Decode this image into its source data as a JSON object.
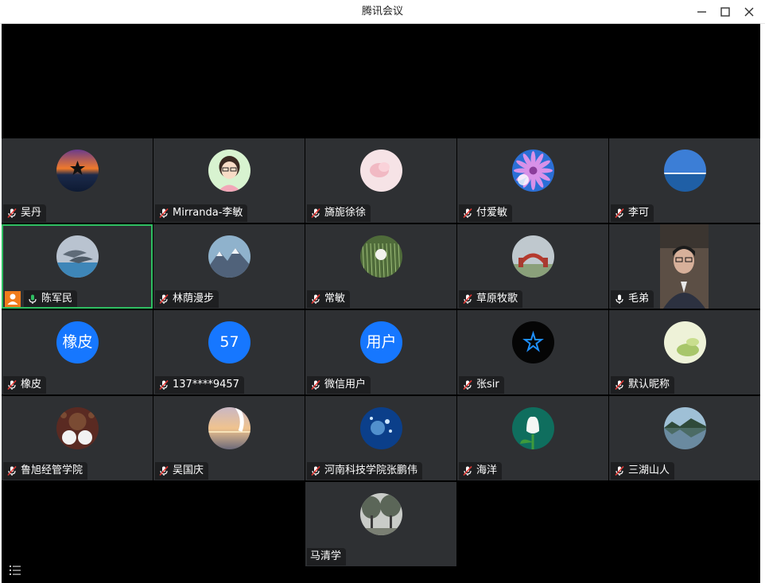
{
  "window": {
    "title": "腾讯会议"
  },
  "colors": {
    "accent_blue": "#1677ff",
    "active_border": "#2fbf62",
    "tile_bg": "#2e3033",
    "muted_red": "#e53935",
    "mic_on": "#2fbf62"
  },
  "participants": [
    {
      "name": "吴丹",
      "mic": "muted",
      "avatar": "sunset-star"
    },
    {
      "name": "Mirranda-李敏",
      "mic": "muted",
      "avatar": "cartoon-girl"
    },
    {
      "name": "旖旎徐徐",
      "mic": "muted",
      "avatar": "pink-flower"
    },
    {
      "name": "付爱敏",
      "mic": "muted",
      "avatar": "purple-daisy"
    },
    {
      "name": "李可",
      "mic": "muted",
      "avatar": "blue-sea"
    },
    {
      "name": "陈军民",
      "mic": "on",
      "avatar": "dolphins",
      "active": true,
      "host": true
    },
    {
      "name": "林荫漫步",
      "mic": "muted",
      "avatar": "mountains"
    },
    {
      "name": "常敏",
      "mic": "muted",
      "avatar": "dandelion"
    },
    {
      "name": "草原牧歌",
      "mic": "muted",
      "avatar": "gate"
    },
    {
      "name": "毛弟",
      "mic": "on-white",
      "avatar": "video"
    },
    {
      "name": "橡皮",
      "mic": "muted",
      "avatar_text": "橡皮"
    },
    {
      "name": "137****9457",
      "mic": "muted",
      "avatar_text": "57"
    },
    {
      "name": "微信用户",
      "mic": "muted",
      "avatar_text": "用户"
    },
    {
      "name": "张sir",
      "mic": "muted",
      "avatar": "blue-star"
    },
    {
      "name": "默认昵称",
      "mic": "muted",
      "avatar": "green-tea"
    },
    {
      "name": "鲁旭经管学院",
      "mic": "muted",
      "avatar": "bears"
    },
    {
      "name": "吴国庆",
      "mic": "muted",
      "avatar": "dusk-lake"
    },
    {
      "name": "河南科技学院张鹏伟",
      "mic": "muted",
      "avatar": "dandelion-blue"
    },
    {
      "name": "海洋",
      "mic": "muted",
      "avatar": "white-tulip"
    },
    {
      "name": "三湖山人",
      "mic": "muted",
      "avatar": "lake-reflection"
    },
    {
      "name": "马清学",
      "mic": "none",
      "avatar": "trees"
    }
  ],
  "toolbar": {
    "list_icon": "list-icon"
  }
}
